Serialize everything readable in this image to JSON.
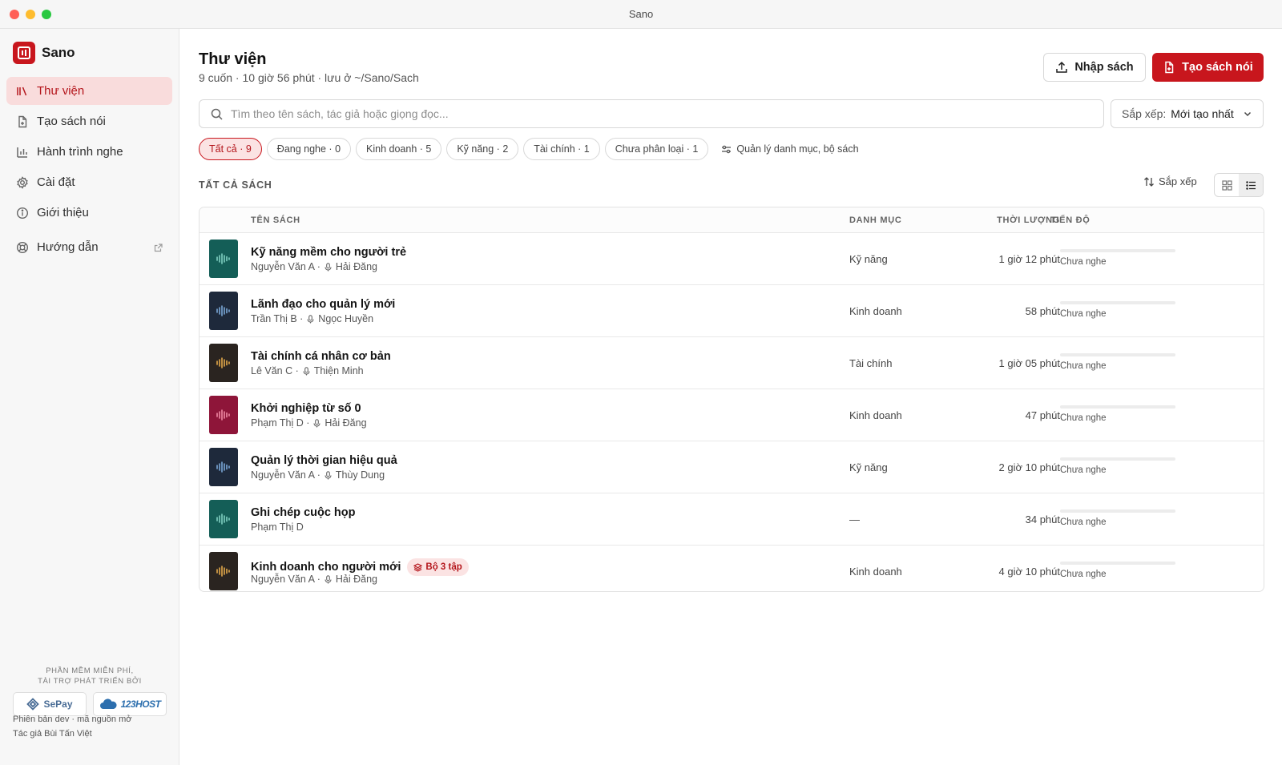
{
  "window": {
    "title": "Sano"
  },
  "sidebar": {
    "brand": "Sano",
    "items": [
      {
        "label": "Thư viện",
        "icon": "library-icon",
        "active": true
      },
      {
        "label": "Tạo sách nói",
        "icon": "new-file-icon",
        "active": false
      },
      {
        "label": "Hành trình nghe",
        "icon": "bar-chart-icon",
        "active": false
      },
      {
        "label": "Cài đặt",
        "icon": "gear-icon",
        "active": false
      },
      {
        "label": "Giới thiệu",
        "icon": "info-icon",
        "active": false
      }
    ],
    "guide": {
      "label": "Hướng dẫn",
      "icon": "lifebuoy-icon"
    },
    "sponsor_caption_1": "PHẦN MỀM MIỄN PHÍ,",
    "sponsor_caption_2": "TÀI TRỢ PHÁT TRIỂN BỞI",
    "sponsors": [
      "SePay",
      "123HOST"
    ],
    "footer_line_1": "Phiên bản dev · mã nguồn mở",
    "footer_line_2": "Tác giả Bùi Tấn Việt"
  },
  "header": {
    "title": "Thư viện",
    "subtitle": "9 cuốn · 10 giờ 56 phút · lưu ở ~/Sano/Sach",
    "import_label": "Nhập sách",
    "create_label": "Tạo sách nói"
  },
  "search": {
    "placeholder": "Tìm theo tên sách, tác giả hoặc giọng đọc..."
  },
  "sort_select": {
    "label": "Sắp xếp:",
    "value": "Mới tạo nhất"
  },
  "filters": {
    "chips": [
      {
        "label": "Tất cả · 9",
        "active": true
      },
      {
        "label": "Đang nghe · 0",
        "active": false
      },
      {
        "label": "Kinh doanh · 5",
        "active": false
      },
      {
        "label": "Kỹ năng · 2",
        "active": false
      },
      {
        "label": "Tài chính · 1",
        "active": false
      },
      {
        "label": "Chưa phân loại · 1",
        "active": false
      }
    ],
    "manage_label": "Quản lý danh mục, bộ sách"
  },
  "list": {
    "section_title": "TẤT CẢ SÁCH",
    "sort_label": "Sắp xếp",
    "view_mode": "list",
    "columns": {
      "title": "TÊN SÁCH",
      "category": "DANH MỤC",
      "duration": "THỜI LƯỢNG",
      "progress": "TIẾN ĐỘ"
    },
    "rows": [
      {
        "title": "Kỹ năng mềm cho người trẻ",
        "author": "Nguyễn Văn A ·",
        "narrator": "Hải Đăng",
        "category": "Kỹ năng",
        "duration": "1 giờ 12 phút",
        "progress_text": "Chưa nghe",
        "progress": 0,
        "cover_bg": "#145e57",
        "cover_fg": "#7fd0c2",
        "badge": ""
      },
      {
        "title": "Lãnh đạo cho quản lý mới",
        "author": "Trần Thị B ·",
        "narrator": "Ngọc Huyền",
        "category": "Kinh doanh",
        "duration": "58 phút",
        "progress_text": "Chưa nghe",
        "progress": 0,
        "cover_bg": "#1e293b",
        "cover_fg": "#7aa8d8",
        "badge": ""
      },
      {
        "title": "Tài chính cá nhân cơ bản",
        "author": "Lê Văn C ·",
        "narrator": "Thiện Minh",
        "category": "Tài chính",
        "duration": "1 giờ 05 phút",
        "progress_text": "Chưa nghe",
        "progress": 0,
        "cover_bg": "#2a2420",
        "cover_fg": "#e3a94a",
        "badge": ""
      },
      {
        "title": "Khởi nghiệp từ số 0",
        "author": "Phạm Thị D ·",
        "narrator": "Hải Đăng",
        "category": "Kinh doanh",
        "duration": "47 phút",
        "progress_text": "Chưa nghe",
        "progress": 0,
        "cover_bg": "#8e1539",
        "cover_fg": "#f08aa4",
        "badge": ""
      },
      {
        "title": "Quản lý thời gian hiệu quả",
        "author": "Nguyễn Văn A ·",
        "narrator": "Thùy Dung",
        "category": "Kỹ năng",
        "duration": "2 giờ 10 phút",
        "progress_text": "Chưa nghe",
        "progress": 0,
        "cover_bg": "#1e293b",
        "cover_fg": "#7aa8d8",
        "badge": ""
      },
      {
        "title": "Ghi chép cuộc họp",
        "author": "Phạm Thị D",
        "narrator": "",
        "category": "—",
        "duration": "34 phút",
        "progress_text": "Chưa nghe",
        "progress": 0,
        "cover_bg": "#145e57",
        "cover_fg": "#7fd0c2",
        "badge": ""
      },
      {
        "title": "Kinh doanh cho người mới",
        "author": "Nguyễn Văn A ·",
        "narrator": "Hải Đăng",
        "category": "Kinh doanh",
        "duration": "4 giờ 10 phút",
        "progress_text": "Chưa nghe",
        "progress": 0,
        "cover_bg": "#2a2420",
        "cover_fg": "#e3a94a",
        "badge": "Bộ 3 tập"
      }
    ]
  },
  "colors": {
    "accent": "#c8161d",
    "accent_soft": "#fbe3e3",
    "sidebar_bg": "#f7f7f7"
  }
}
